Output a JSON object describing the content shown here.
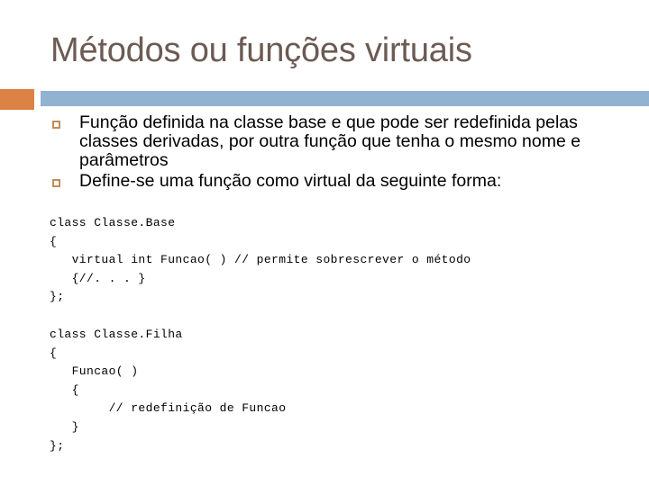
{
  "slide": {
    "title": "Métodos ou funções virtuais",
    "theme": {
      "title_color": "#6C5B53",
      "accent_color": "#DC8244",
      "rule_color": "#92B2D1",
      "bullet_color": "#C28B5B",
      "body_color": "#000000",
      "background": "#ffffff"
    },
    "bullets": [
      {
        "marker": "hollow-square-bullet",
        "text": "Função definida na classe base e que pode ser redefinida pelas classes derivadas, por outra função que tenha o mesmo nome e parâmetros"
      },
      {
        "marker": "hollow-square-bullet",
        "text": "Define-se uma função como virtual da seguinte forma:"
      }
    ],
    "code_blocks": [
      {
        "name": "classe-base-snippet",
        "lines": [
          "class Classe.Base",
          "{",
          "   virtual int Funcao( ) // permite sobrescrever o método",
          "   {//. . . }",
          "};"
        ]
      },
      {
        "name": "classe-filha-snippet",
        "lines": [
          "class Classe.Filha",
          "{",
          "   Funcao( )",
          "   {",
          "        // redefinição de Funcao",
          "   }",
          "};"
        ]
      }
    ]
  }
}
